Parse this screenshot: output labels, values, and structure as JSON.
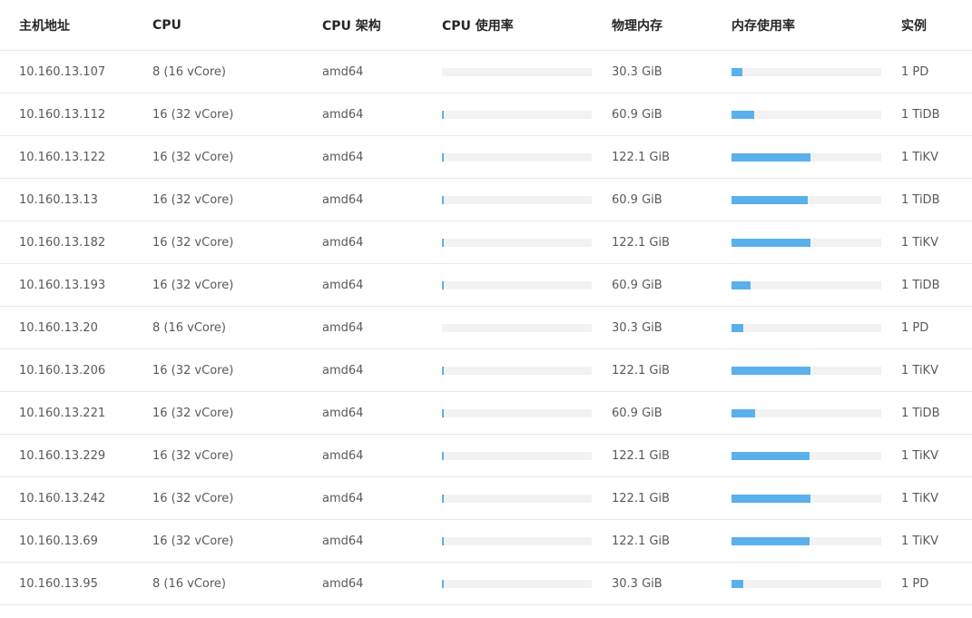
{
  "colors": {
    "bar_fill": "#5ab0eb",
    "bar_track": "#f2f2f2",
    "border": "#e8e8e8"
  },
  "table": {
    "headers": {
      "host": "主机地址",
      "cpu": "CPU",
      "arch": "CPU 架构",
      "cpu_usage": "CPU 使用率",
      "memory": "物理内存",
      "mem_usage": "内存使用率",
      "instances": "实例"
    },
    "rows": [
      {
        "host": "10.160.13.107",
        "cpu": "8 (16 vCore)",
        "arch": "amd64",
        "cpu_usage": 0.0,
        "memory": "30.3 GiB",
        "mem_usage": 0.07,
        "instances": "1 PD"
      },
      {
        "host": "10.160.13.112",
        "cpu": "16 (32 vCore)",
        "arch": "amd64",
        "cpu_usage": 0.01,
        "memory": "60.9 GiB",
        "mem_usage": 0.15,
        "instances": "1 TiDB"
      },
      {
        "host": "10.160.13.122",
        "cpu": "16 (32 vCore)",
        "arch": "amd64",
        "cpu_usage": 0.01,
        "memory": "122.1 GiB",
        "mem_usage": 0.53,
        "instances": "1 TiKV"
      },
      {
        "host": "10.160.13.13",
        "cpu": "16 (32 vCore)",
        "arch": "amd64",
        "cpu_usage": 0.015,
        "memory": "60.9 GiB",
        "mem_usage": 0.51,
        "instances": "1 TiDB"
      },
      {
        "host": "10.160.13.182",
        "cpu": "16 (32 vCore)",
        "arch": "amd64",
        "cpu_usage": 0.01,
        "memory": "122.1 GiB",
        "mem_usage": 0.53,
        "instances": "1 TiKV"
      },
      {
        "host": "10.160.13.193",
        "cpu": "16 (32 vCore)",
        "arch": "amd64",
        "cpu_usage": 0.01,
        "memory": "60.9 GiB",
        "mem_usage": 0.13,
        "instances": "1 TiDB"
      },
      {
        "host": "10.160.13.20",
        "cpu": "8 (16 vCore)",
        "arch": "amd64",
        "cpu_usage": 0.0,
        "memory": "30.3 GiB",
        "mem_usage": 0.08,
        "instances": "1 PD"
      },
      {
        "host": "10.160.13.206",
        "cpu": "16 (32 vCore)",
        "arch": "amd64",
        "cpu_usage": 0.01,
        "memory": "122.1 GiB",
        "mem_usage": 0.53,
        "instances": "1 TiKV"
      },
      {
        "host": "10.160.13.221",
        "cpu": "16 (32 vCore)",
        "arch": "amd64",
        "cpu_usage": 0.01,
        "memory": "60.9 GiB",
        "mem_usage": 0.16,
        "instances": "1 TiDB"
      },
      {
        "host": "10.160.13.229",
        "cpu": "16 (32 vCore)",
        "arch": "amd64",
        "cpu_usage": 0.01,
        "memory": "122.1 GiB",
        "mem_usage": 0.52,
        "instances": "1 TiKV"
      },
      {
        "host": "10.160.13.242",
        "cpu": "16 (32 vCore)",
        "arch": "amd64",
        "cpu_usage": 0.015,
        "memory": "122.1 GiB",
        "mem_usage": 0.53,
        "instances": "1 TiKV"
      },
      {
        "host": "10.160.13.69",
        "cpu": "16 (32 vCore)",
        "arch": "amd64",
        "cpu_usage": 0.01,
        "memory": "122.1 GiB",
        "mem_usage": 0.52,
        "instances": "1 TiKV"
      },
      {
        "host": "10.160.13.95",
        "cpu": "8 (16 vCore)",
        "arch": "amd64",
        "cpu_usage": 0.015,
        "memory": "30.3 GiB",
        "mem_usage": 0.08,
        "instances": "1 PD"
      }
    ]
  }
}
